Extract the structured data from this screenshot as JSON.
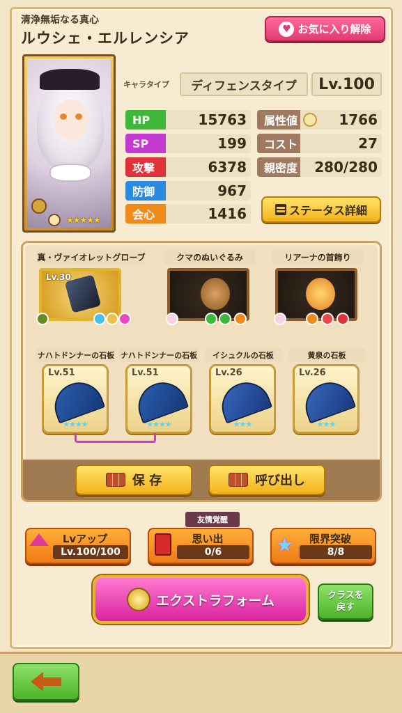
{
  "header": {
    "subtitle": "清浄無垢なる真心",
    "name": "ルウシェ・エルレンシア",
    "fav_label": "お気に入り解除"
  },
  "character": {
    "type_label": "キャラタイプ",
    "type_value": "ディフェンスタイプ",
    "level": "Lv.100",
    "stars": "★★★★★"
  },
  "stats": {
    "hp": {
      "label": "HP",
      "value": "15763",
      "color": "#3fb83a"
    },
    "sp": {
      "label": "SP",
      "value": "199",
      "color": "#c23ad0"
    },
    "atk": {
      "label": "攻撃",
      "value": "6378",
      "color": "#e0303a"
    },
    "def": {
      "label": "防御",
      "value": "967",
      "color": "#2a8ae0"
    },
    "crit": {
      "label": "会心",
      "value": "1416",
      "color": "#f08a1a"
    },
    "attr": {
      "label": "属性値",
      "value": "1766",
      "color": "#a07a60"
    },
    "cost": {
      "label": "コスト",
      "value": "27",
      "color": "#a07a60"
    },
    "affinity": {
      "label": "親密度",
      "value": "280/280",
      "color": "#a07a60"
    }
  },
  "status_button": "ステータス詳細",
  "equipment": [
    {
      "title": "真・ヴァイオレットグローブ",
      "level": "Lv.30"
    },
    {
      "title": "クマのぬいぐるみ",
      "level": ""
    },
    {
      "title": "リアーナの首飾り",
      "level": ""
    }
  ],
  "stones": [
    {
      "title": "ナハトドンナーの石板",
      "level": "Lv.51",
      "stars": "★★★★"
    },
    {
      "title": "ナハトドンナーの石板",
      "level": "Lv.51",
      "stars": "★★★★"
    },
    {
      "title": "イシュクルの石板",
      "level": "Lv.26",
      "stars": "★★★"
    },
    {
      "title": "黄泉の石板",
      "level": "Lv.26",
      "stars": "★★★"
    }
  ],
  "actions": {
    "save": "保 存",
    "recall": "呼び出し"
  },
  "bottom": {
    "friendship_tag": "友情覚醒",
    "lvup_title": "Lvアップ",
    "lvup_value": "Lv.100/100",
    "memory_title": "思い出",
    "memory_value": "0/6",
    "limit_title": "限界突破",
    "limit_value": "8/8",
    "extra_form": "エクストラフォーム",
    "class_back_line1": "クラスを",
    "class_back_line2": "戻す"
  }
}
